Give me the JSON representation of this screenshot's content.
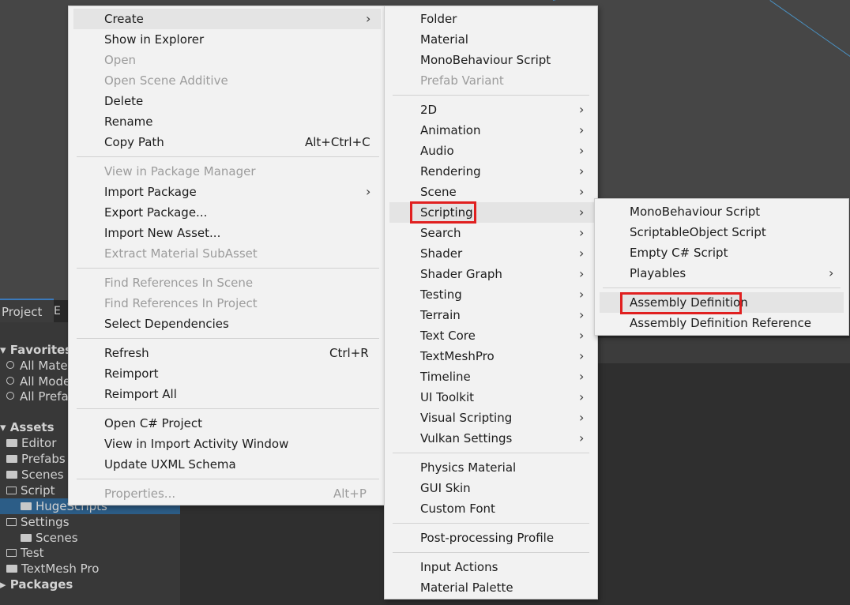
{
  "project_tab": {
    "label": "Project",
    "second_tab_glyph": "E"
  },
  "project_tree": {
    "favorites_header": "Favorites",
    "favorites": [
      "All Mate",
      "All Mode",
      "All Prefa"
    ],
    "assets_header": "Assets",
    "assets_folders": [
      "Editor",
      "Prefabs",
      "Scenes",
      "Script"
    ],
    "script_child": "HugeScripts",
    "settings": "Settings",
    "settings_child": "Scenes",
    "test": "Test",
    "textmesh": "TextMesh Pro",
    "packages_header": "Packages"
  },
  "context_menu": {
    "create": "Create",
    "show_in_explorer": "Show in Explorer",
    "open": "Open",
    "open_scene_additive": "Open Scene Additive",
    "delete": "Delete",
    "rename": "Rename",
    "copy_path": "Copy Path",
    "copy_path_shortcut": "Alt+Ctrl+C",
    "view_in_package_manager": "View in Package Manager",
    "import_package": "Import Package",
    "export_package": "Export Package...",
    "import_new_asset": "Import New Asset...",
    "extract_material_subasset": "Extract Material SubAsset",
    "find_refs_scene": "Find References In Scene",
    "find_refs_project": "Find References In Project",
    "select_dependencies": "Select Dependencies",
    "refresh": "Refresh",
    "refresh_shortcut": "Ctrl+R",
    "reimport": "Reimport",
    "reimport_all": "Reimport All",
    "open_csharp_project": "Open C# Project",
    "view_import_activity": "View in Import Activity Window",
    "update_uxml_schema": "Update UXML Schema",
    "properties": "Properties...",
    "properties_shortcut": "Alt+P"
  },
  "create_menu": {
    "folder": "Folder",
    "material": "Material",
    "monobehaviour_script": "MonoBehaviour Script",
    "prefab_variant": "Prefab Variant",
    "2d": "2D",
    "animation": "Animation",
    "audio": "Audio",
    "rendering": "Rendering",
    "scene": "Scene",
    "scripting": "Scripting",
    "search": "Search",
    "shader": "Shader",
    "shader_graph": "Shader Graph",
    "testing": "Testing",
    "terrain": "Terrain",
    "text_core": "Text Core",
    "textmeshpro": "TextMeshPro",
    "timeline": "Timeline",
    "ui_toolkit": "UI Toolkit",
    "visual_scripting": "Visual Scripting",
    "vulkan_settings": "Vulkan Settings",
    "physics_material": "Physics Material",
    "gui_skin": "GUI Skin",
    "custom_font": "Custom Font",
    "post_processing_profile": "Post-processing Profile",
    "input_actions": "Input Actions",
    "material_palette": "Material Palette"
  },
  "scripting_menu": {
    "monobehaviour_script": "MonoBehaviour Script",
    "scriptableobject_script": "ScriptableObject Script",
    "empty_csharp_script": "Empty C# Script",
    "playables": "Playables",
    "assembly_definition": "Assembly Definition",
    "assembly_definition_reference": "Assembly Definition Reference"
  },
  "icons": {
    "submenu": "chevron-right-icon",
    "search": "search-icon",
    "folder": "folder-icon"
  },
  "colors": {
    "highlight_box": "#e02020",
    "selection": "#2c5d87",
    "menu_bg": "#f2f2f2"
  }
}
